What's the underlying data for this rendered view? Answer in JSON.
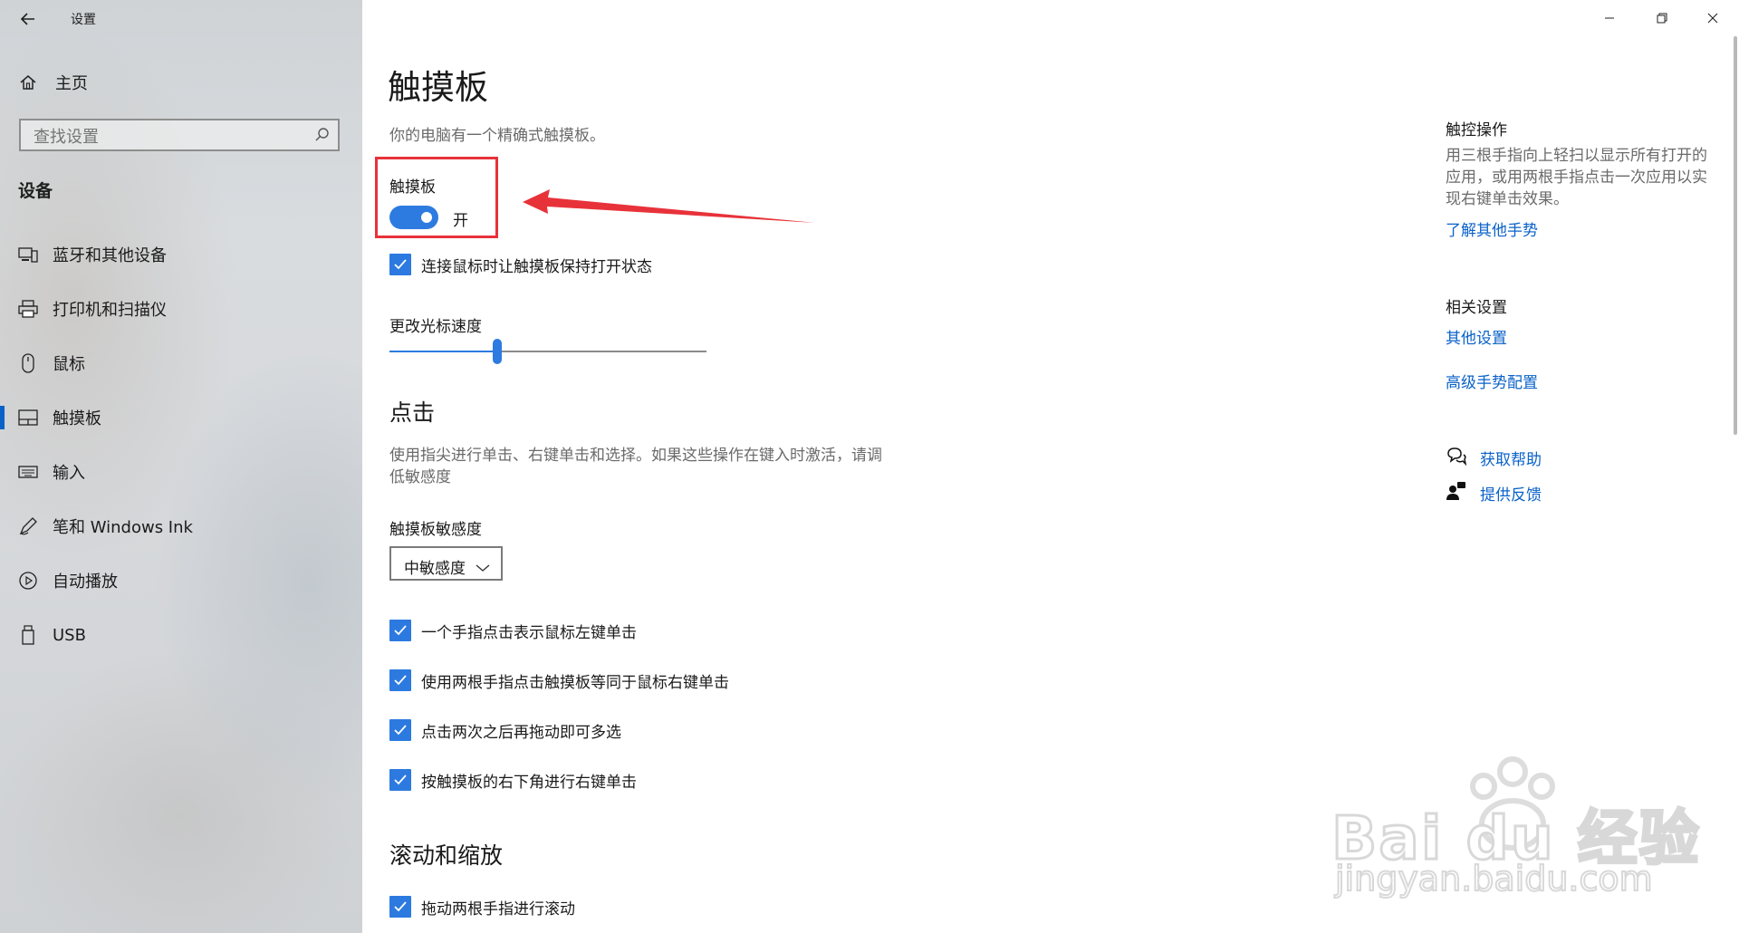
{
  "window": {
    "title": "设置",
    "controls": [
      "minimize-icon",
      "restore-icon",
      "close-icon"
    ]
  },
  "sidebar": {
    "home_label": "主页",
    "search_placeholder": "查找设置",
    "section_title": "设备",
    "items": [
      {
        "label": "蓝牙和其他设备",
        "icon": "bluetooth-devices-icon"
      },
      {
        "label": "打印机和扫描仪",
        "icon": "printer-icon"
      },
      {
        "label": "鼠标",
        "icon": "mouse-icon"
      },
      {
        "label": "触摸板",
        "icon": "touchpad-icon",
        "selected": true
      },
      {
        "label": "输入",
        "icon": "keyboard-icon"
      },
      {
        "label": "笔和 Windows Ink",
        "icon": "pen-icon"
      },
      {
        "label": "自动播放",
        "icon": "autoplay-icon"
      },
      {
        "label": "USB",
        "icon": "usb-icon"
      }
    ]
  },
  "main": {
    "title": "触摸板",
    "description": "你的电脑有一个精确式触摸板。",
    "touchpad_toggle": {
      "label": "触摸板",
      "state": "开",
      "on": true
    },
    "keep_on_with_mouse": {
      "label": "连接鼠标时让触摸板保持打开状态",
      "checked": true
    },
    "cursor_speed": {
      "label": "更改光标速度",
      "value_percent": 34
    },
    "taps_section": {
      "title": "点击",
      "description_line1": "使用指尖进行单击、右键单击和选择。如果这些操作在键入时激活，请调",
      "description_line2": "低敏感度",
      "sensitivity_label": "触摸板敏感度",
      "sensitivity_value": "中敏感度",
      "options": [
        {
          "label": "一个手指点击表示鼠标左键单击",
          "checked": true
        },
        {
          "label": "使用两根手指点击触摸板等同于鼠标右键单击",
          "checked": true
        },
        {
          "label": "点击两次之后再拖动即可多选",
          "checked": true
        },
        {
          "label": "按触摸板的右下角进行右键单击",
          "checked": true
        }
      ]
    },
    "scroll_section": {
      "title": "滚动和缩放",
      "options": [
        {
          "label": "拖动两根手指进行滚动",
          "checked": true
        }
      ]
    }
  },
  "right_panel": {
    "touch_title": "触控操作",
    "touch_desc_line1": "用三根手指向上轻扫以显示所有打开的",
    "touch_desc_line2": "应用，或用两根手指点击一次应用以实",
    "touch_desc_line3": "现右键单击效果。",
    "touch_link": "了解其他手势",
    "related_title": "相关设置",
    "related_links": [
      "其他设置",
      "高级手势配置"
    ],
    "help_link": "获取帮助",
    "feedback_link": "提供反馈"
  },
  "watermark": {
    "brand": "Bai du 经验",
    "domain": "jingyan.baidu.com"
  },
  "colors": {
    "accent": "#2d7be1",
    "link": "#0a62c9",
    "annotation_red": "#e8323a"
  }
}
